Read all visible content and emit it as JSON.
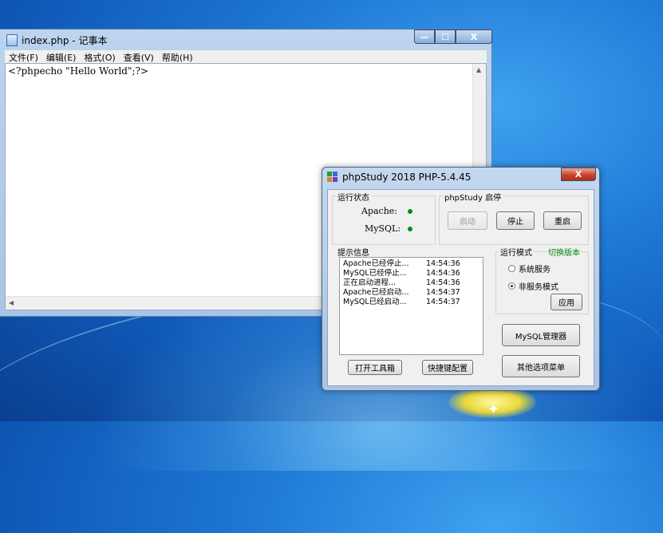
{
  "notepad": {
    "title": "index.php - 记事本",
    "menu": [
      "文件(F)",
      "编辑(E)",
      "格式(O)",
      "查看(V)",
      "帮助(H)"
    ],
    "content": "<?phpecho \"Hello World\";?>",
    "caption": {
      "min": "—",
      "max": "☐",
      "close": "X"
    }
  },
  "phpstudy": {
    "title": "phpStudy 2018   PHP-5.4.45",
    "close": "X",
    "status_group": "运行状态",
    "services": [
      {
        "name": "Apache:",
        "status_color": "#0a8a14"
      },
      {
        "name": "MySQL:",
        "status_color": "#0a8a14"
      }
    ],
    "control_group": "phpStudy 启停",
    "buttons": {
      "start": "启动",
      "stop": "停止",
      "restart": "重启",
      "apply": "应用",
      "mysql_manager": "MySQL管理器",
      "toolbox": "打开工具箱",
      "hotkey": "快捷键配置",
      "other_menu": "其他选项菜单"
    },
    "log_group": "提示信息",
    "log": [
      {
        "msg": "Apache已经停止...",
        "time": "14:54:36"
      },
      {
        "msg": "MySQL已经停止...",
        "time": "14:54:36"
      },
      {
        "msg": "正在启动进程...",
        "time": "14:54:36"
      },
      {
        "msg": "Apache已经启动...",
        "time": "14:54:37"
      },
      {
        "msg": "MySQL已经启动...",
        "time": "14:54:37"
      }
    ],
    "mode_group": "运行模式",
    "switch_version": "切换版本",
    "modes": [
      {
        "label": "系统服务",
        "selected": false
      },
      {
        "label": "非服务模式",
        "selected": true
      }
    ]
  }
}
